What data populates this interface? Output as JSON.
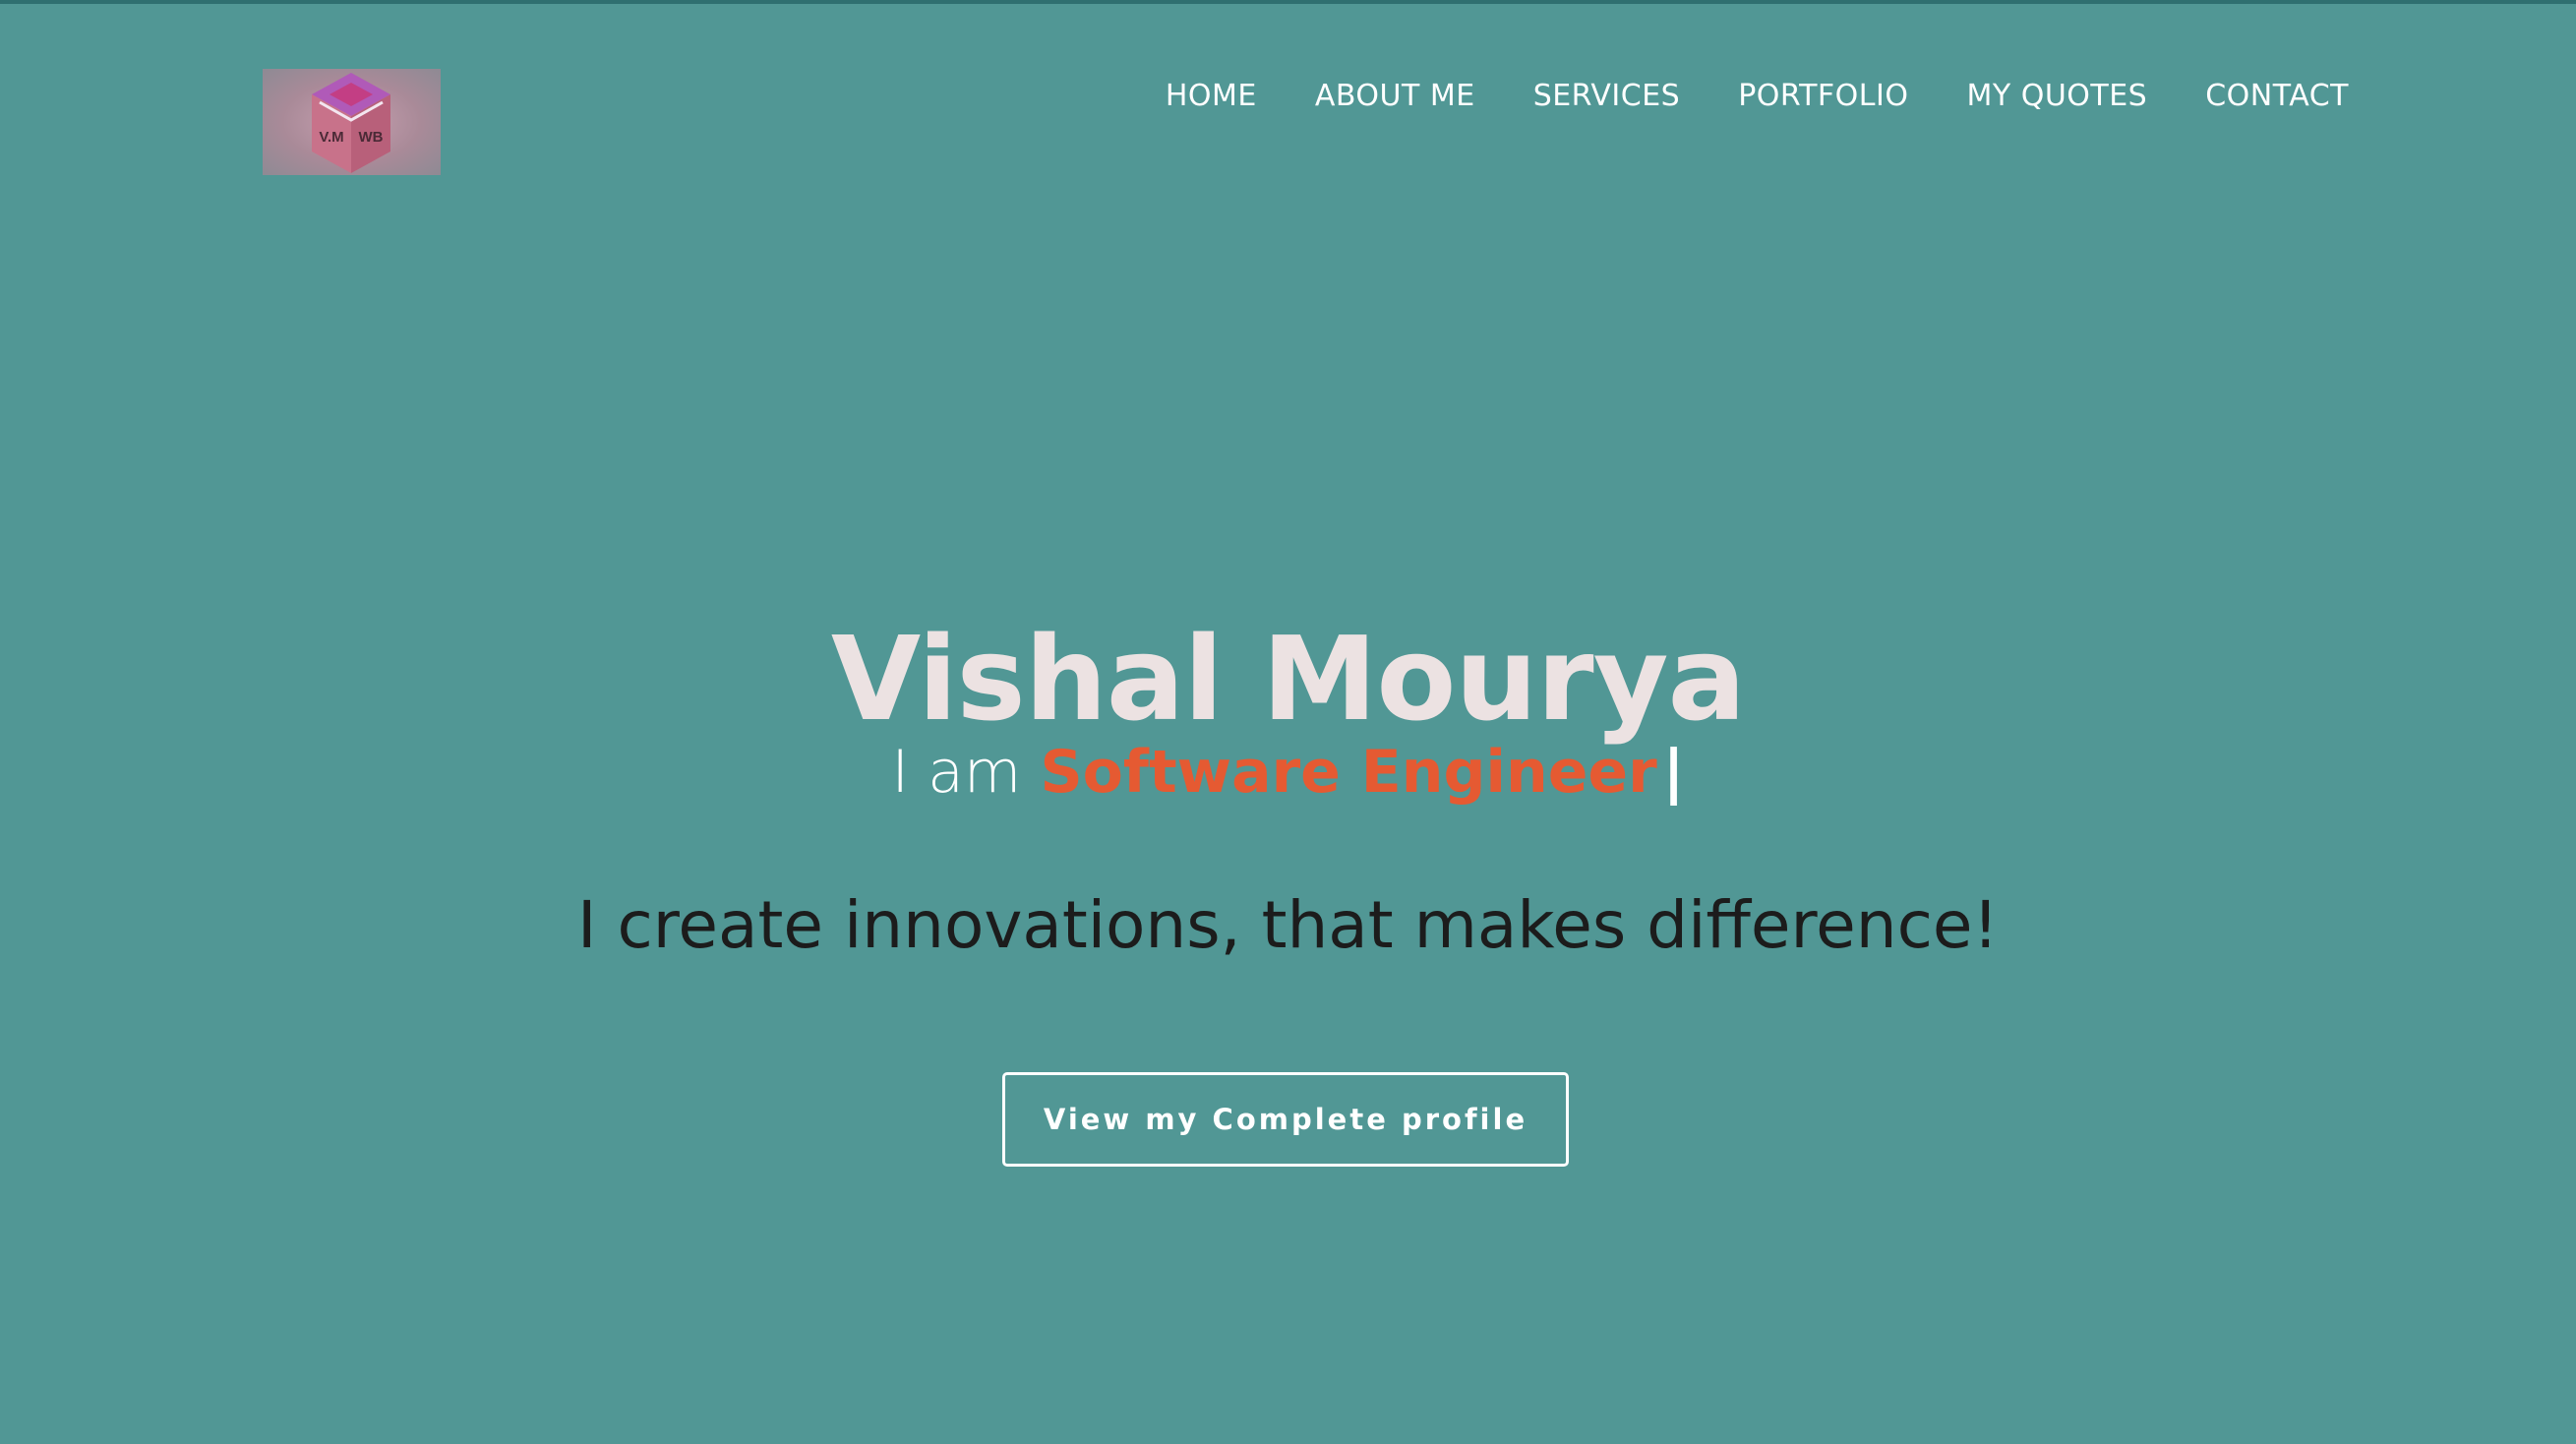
{
  "logo": {
    "text_left": "V.M",
    "text_right": "WB",
    "icon": "cube-logo-icon"
  },
  "nav": {
    "items": [
      {
        "label": "HOME"
      },
      {
        "label": "ABOUT ME"
      },
      {
        "label": "SERVICES"
      },
      {
        "label": "PORTFOLIO"
      },
      {
        "label": "MY QUOTES"
      },
      {
        "label": "CONTACT"
      }
    ]
  },
  "hero": {
    "name": "Vishal Mourya",
    "role_prefix": "I am ",
    "role_word": "Software Engineer",
    "cursor": "|",
    "tagline": "I create innovations, that makes difference!",
    "button_label": "View my Complete profile"
  },
  "colors": {
    "background": "#519795",
    "accent": "#e55a32",
    "name": "#ece2e2",
    "tagline": "#1c1c1c"
  }
}
